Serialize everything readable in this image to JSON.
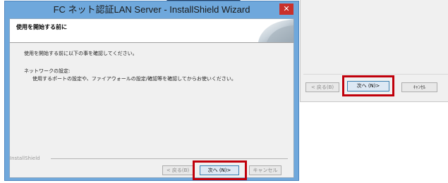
{
  "dialog": {
    "title": "FC ネット認証LAN Server - InstallShield Wizard",
    "close_glyph": "✕",
    "header_title": "使用を開始する前に",
    "intro_text": "使用を開始する前に以下の事を確認してください。",
    "section_label": "ネットワークの設定:",
    "section_detail": "使用するポートの設定や、ファイアウォールの設定/確認等を確認してからお使いください。",
    "installshield_label": "InstallShield",
    "back_button": "< 戻る(B)",
    "next_button": "次へ (N)>",
    "cancel_button": "キャンセル"
  },
  "secondary": {
    "back_button": "< 戻る(B)",
    "next_button": "次へ (N)>",
    "cancel_button": "ｷｬﾝｾﾙ"
  },
  "colors": {
    "highlight": "#c0000b",
    "title_bar": "#6fa8dc",
    "close_button": "#c9302c"
  }
}
